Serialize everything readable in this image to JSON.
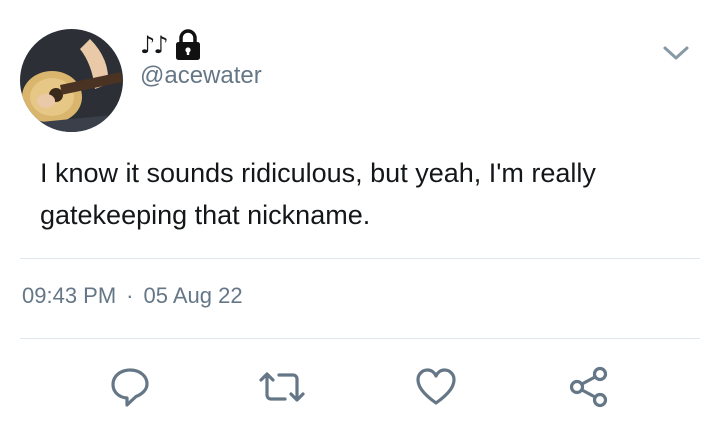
{
  "header": {
    "display_name": "♪♪",
    "handle": "@acewater",
    "avatar_icon": "guitar-player-avatar",
    "lock_icon": "lock-icon",
    "menu_icon": "chevron-down-icon"
  },
  "tweet": {
    "text": "I know it sounds ridiculous, but yeah, I'm really gatekeeping that nickname.",
    "time": "09:43 PM",
    "separator": "·",
    "date": "05 Aug 22"
  },
  "actions": [
    {
      "name": "reply",
      "icon": "reply-icon"
    },
    {
      "name": "retweet",
      "icon": "retweet-icon"
    },
    {
      "name": "like",
      "icon": "heart-icon"
    },
    {
      "name": "share",
      "icon": "share-icon"
    }
  ],
  "colors": {
    "text": "#14171a",
    "secondary": "#657786",
    "divider": "#e1e8ed"
  }
}
